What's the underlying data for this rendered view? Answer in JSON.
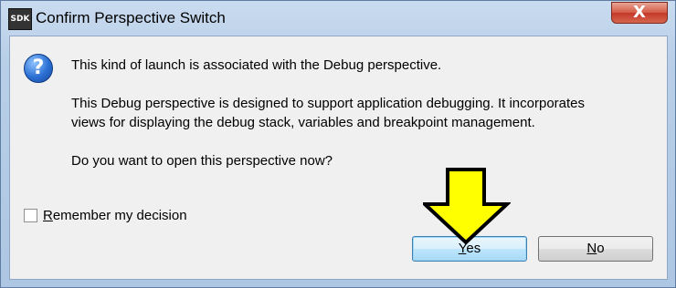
{
  "window": {
    "app_icon_text": "SDK",
    "title": "Confirm Perspective Switch",
    "close_glyph": "X"
  },
  "message": {
    "line1": "This kind of launch is associated with the Debug perspective.",
    "line2": "This Debug perspective is designed to support application debugging.  It incorporates",
    "line3": "views for displaying the debug stack, variables and breakpoint management.",
    "line4": "Do you want to open this perspective now?"
  },
  "remember": {
    "label_first": "R",
    "label_rest": "emember my decision",
    "checked": false
  },
  "buttons": {
    "yes_first": "Y",
    "yes_rest": "es",
    "no_first": "N",
    "no_rest": "o"
  },
  "icons": {
    "question": "question-icon",
    "arrow": "yellow-down-arrow-icon"
  },
  "colors": {
    "arrow_fill": "#ffff00",
    "arrow_stroke": "#000000",
    "title_bar": "#b9cfe8",
    "close_button": "#c4382a"
  }
}
